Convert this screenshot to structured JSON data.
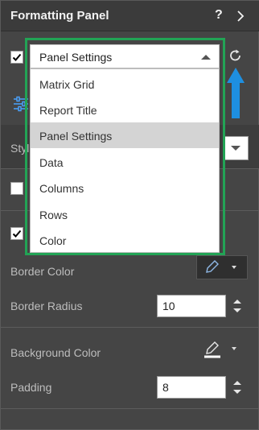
{
  "panel": {
    "title": "Formatting Panel",
    "help": "?",
    "icons": [
      "help-icon",
      "chevron-right-icon"
    ]
  },
  "header_row": {
    "enabled": true,
    "selected": "Panel Settings",
    "reset_icon": "reset-icon",
    "arrow_icon": "blue-arrow-up-icon"
  },
  "dropdown": {
    "options": [
      "Matrix Grid",
      "Report Title",
      "Panel Settings",
      "Data",
      "Columns",
      "Rows",
      "Color"
    ],
    "selected_index": 2,
    "highlight_color": "#22a355"
  },
  "obscured": {
    "style_label": "Styl",
    "tab_icon": "format-sliders-icon"
  },
  "settings": {
    "border_color_label": "Border Color",
    "border_radius_label": "Border Radius",
    "border_radius_value": "10",
    "background_color_label": "Background Color",
    "padding_label": "Padding",
    "padding_value": "8"
  },
  "colors": {
    "accent_arrow": "#1e8fe0",
    "panel_bg": "#454545"
  }
}
